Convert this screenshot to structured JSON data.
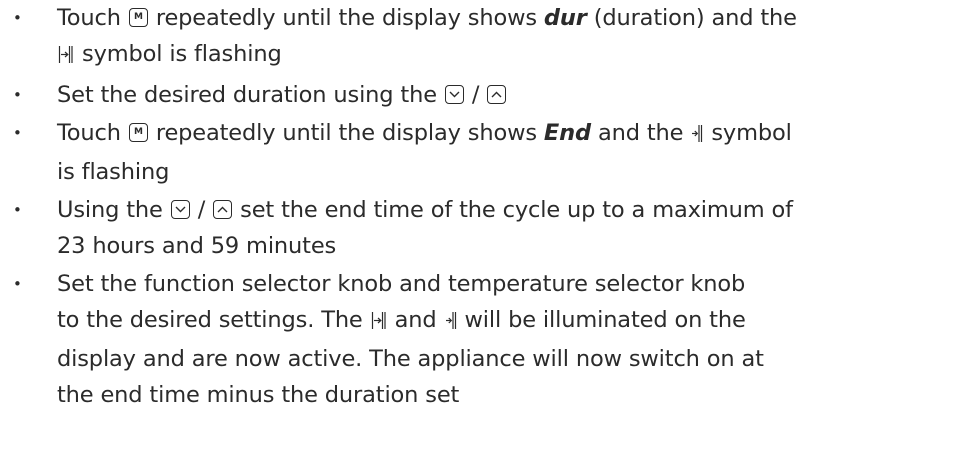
{
  "instructions": {
    "bullet": "•",
    "items": [
      {
        "lines": [
          {
            "a": "Touch ",
            "b": " repeatedly until the display shows ",
            "bold": "dur",
            "c": " (duration) and the"
          },
          {
            "a": " symbol is flashing"
          }
        ]
      },
      {
        "lines": [
          {
            "a": "Set the desired duration using the ",
            "sep": " / "
          }
        ]
      },
      {
        "lines": [
          {
            "a": "Touch ",
            "b": " repeatedly until the display shows ",
            "bold": "End",
            "c": " and the ",
            "d": " symbol"
          },
          {
            "a": "is flashing"
          }
        ]
      },
      {
        "lines": [
          {
            "a": "Using the ",
            "sep": " / ",
            "c": " set the end time of the cycle up to a maximum of"
          },
          {
            "a": "23 hours and 59 minutes"
          }
        ]
      },
      {
        "lines": [
          {
            "a": "Set the function selector knob and temperature selector knob"
          },
          {
            "a": "to the desired settings. The ",
            "b": " and ",
            "c": " will be illuminated on the"
          },
          {
            "a": "display and are now active. The appliance will now switch on at"
          },
          {
            "a": "the end time minus the duration set"
          }
        ]
      }
    ],
    "mode_key_letter": "M",
    "icons": {
      "mode_key": "mode-key-icon",
      "down_key": "down-arrow-key-icon",
      "up_key": "up-arrow-key-icon",
      "duration_symbol": "duration-symbol-icon",
      "end_symbol": "end-time-symbol-icon"
    },
    "text_color": "#2b2b2b"
  }
}
